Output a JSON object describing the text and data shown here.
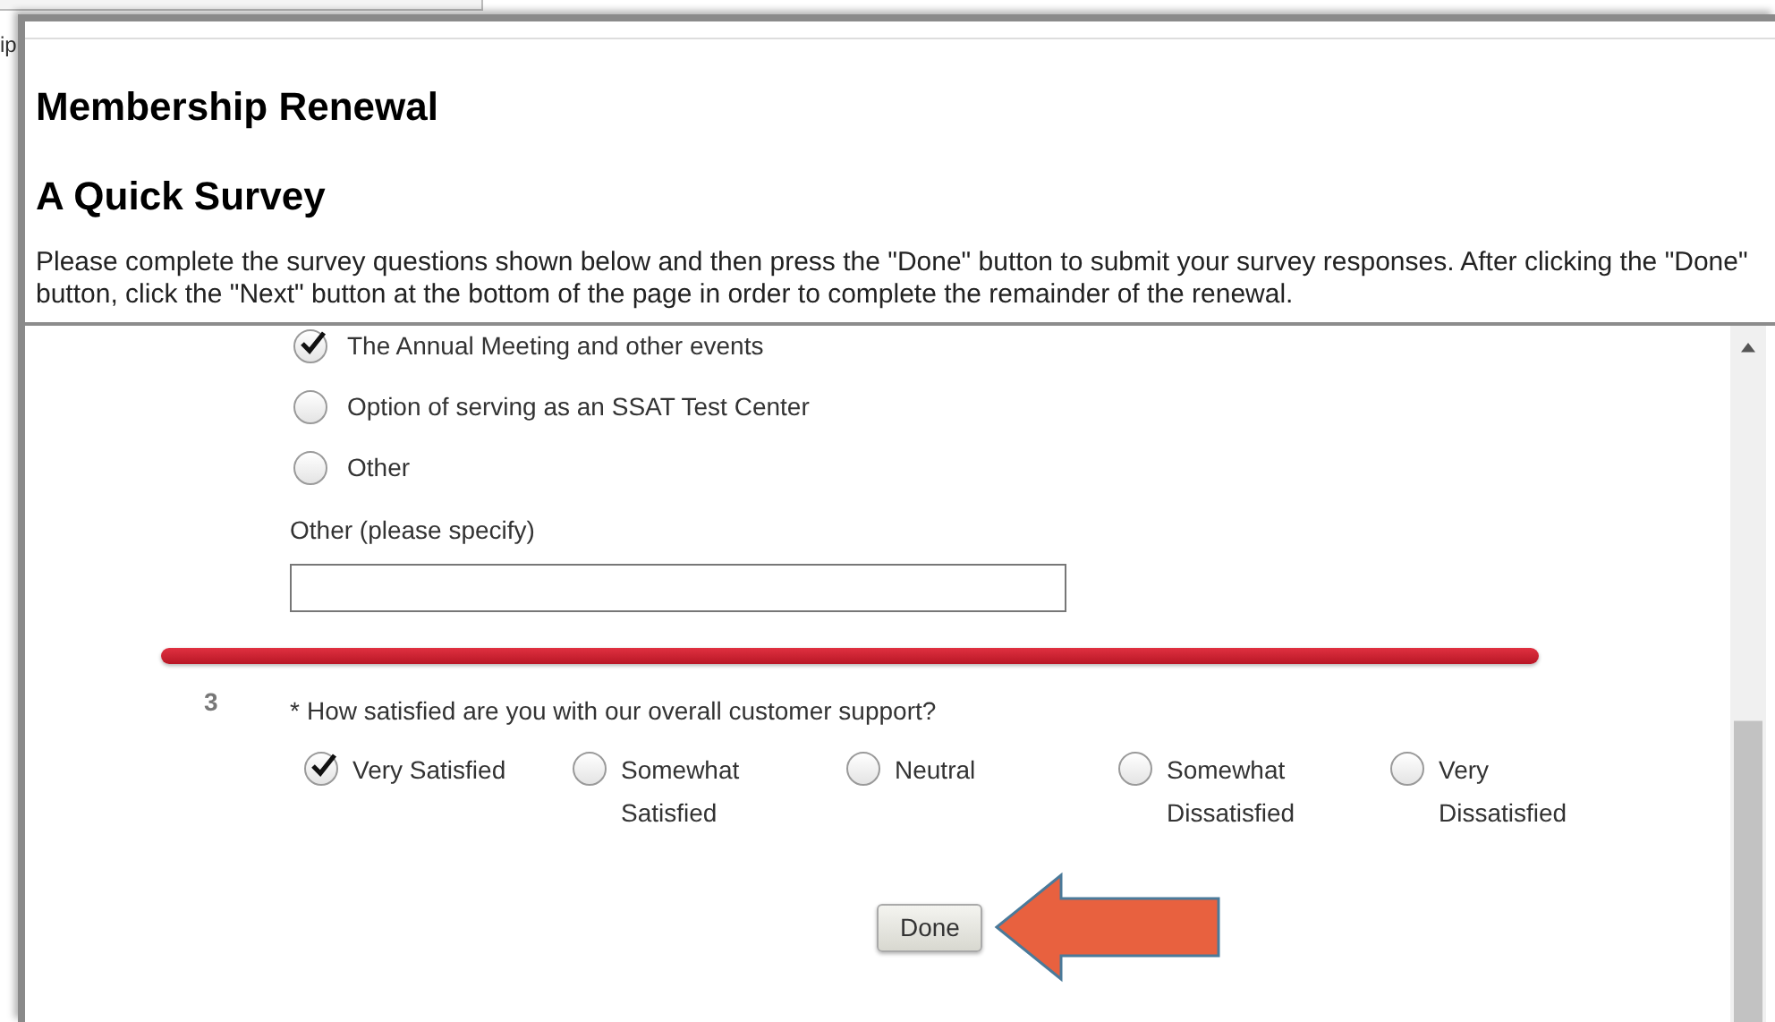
{
  "background": {
    "text": "ip"
  },
  "dialog": {
    "title": "Membership Renewal",
    "subtitle": "A Quick Survey",
    "instructions": "Please complete the survey questions shown below and then press the \"Done\" button to submit your survey responses. After clicking the \"Done\" button, click the \"Next\" button at the bottom of the page in order to complete the remainder of the renewal.",
    "survey": {
      "previous_options": [
        {
          "label": "The Annual Meeting and other events",
          "selected": true
        },
        {
          "label": "Option of serving as an SSAT Test Center",
          "selected": false
        },
        {
          "label": "Other",
          "selected": false
        }
      ],
      "other_field": {
        "label": "Other (please specify)"
      },
      "question": {
        "number": "3",
        "required_mark": "*",
        "text": "How satisfied are you with our overall customer support?",
        "options": [
          {
            "label": "Very Satisfied",
            "selected": true
          },
          {
            "label": "Somewhat Satisfied",
            "selected": false
          },
          {
            "label": "Neutral",
            "selected": false
          },
          {
            "label": "Somewhat Dissatisfied",
            "selected": false
          },
          {
            "label": "Very Dissatisfied",
            "selected": false
          }
        ]
      },
      "done_button": "Done"
    }
  }
}
